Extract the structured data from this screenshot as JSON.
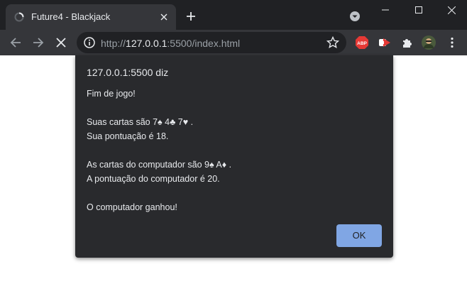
{
  "browser": {
    "tab_title": "Future4 - Blackjack",
    "url_scheme": "http://",
    "url_host": "127.0.0.1",
    "url_rest": ":5500/index.html"
  },
  "dialog": {
    "title": "127.0.0.1:5500 diz",
    "lines": [
      "Fim de jogo!",
      "",
      "Suas cartas são 7♠ 4♣ 7♥ .",
      "Sua pontuação é 18.",
      "",
      "As cartas do computador são 9♠ A♦ .",
      "A pontuação do computador é 20.",
      "",
      "O computador ganhou!"
    ],
    "ok_label": "OK"
  },
  "icons": {
    "abp_label": "ABP"
  },
  "colors": {
    "titlebar": "#202124",
    "toolbar": "#35363a",
    "dialog_bg": "#292a2d",
    "ok_button": "#8ab4f8"
  }
}
